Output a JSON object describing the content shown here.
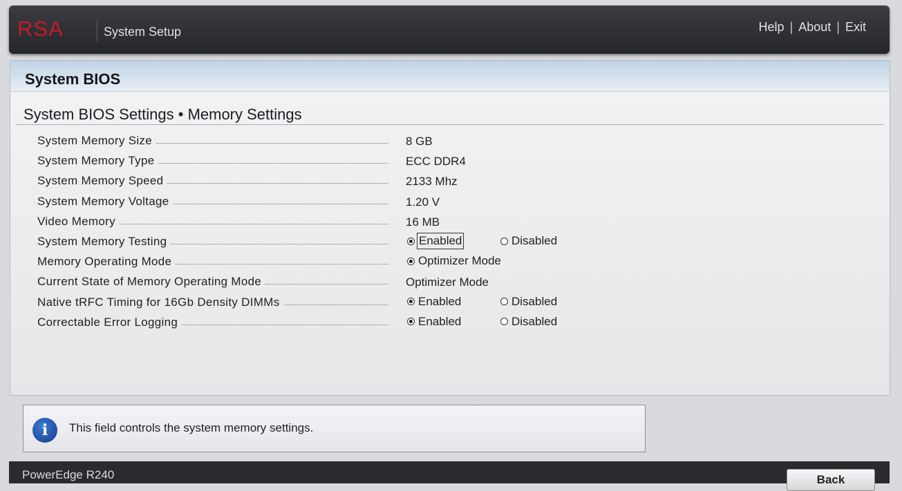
{
  "header": {
    "logo": "RSA",
    "app_title": "System Setup",
    "links": [
      "Help",
      "About",
      "Exit"
    ],
    "separator": "|"
  },
  "panel": {
    "title": "System BIOS",
    "subtitle": "System BIOS Settings • Memory Settings"
  },
  "settings": [
    {
      "label": "System Memory Size",
      "value": "8 GB"
    },
    {
      "label": "System Memory Type",
      "value": "ECC DDR4"
    },
    {
      "label": "System Memory Speed",
      "value": "2133 Mhz"
    },
    {
      "label": "System Memory Voltage",
      "value": "1.20 V"
    },
    {
      "label": "Video Memory",
      "value": "16 MB"
    },
    {
      "label": "System Memory Testing",
      "options": [
        "Enabled",
        "Disabled"
      ],
      "selected": "Enabled"
    },
    {
      "label": "Memory Operating Mode",
      "options": [
        "Optimizer Mode"
      ],
      "selected": "Optimizer Mode"
    },
    {
      "label": "Current State of Memory Operating Mode",
      "value": "Optimizer Mode"
    },
    {
      "label": "Native tRFC Timing for 16Gb Density DIMMs",
      "options": [
        "Enabled",
        "Disabled"
      ],
      "selected": "Enabled"
    },
    {
      "label": "Correctable Error Logging",
      "options": [
        "Enabled",
        "Disabled"
      ],
      "selected": "Enabled"
    }
  ],
  "info": {
    "icon": "info-icon",
    "text": "This field controls the system memory settings."
  },
  "footer": {
    "model": "PowerEdge R240",
    "back_label": "Back"
  },
  "colors": {
    "brand_red": "#c61a26",
    "header_blue": "#bfd3e5",
    "info_blue": "#1f5bb5"
  }
}
